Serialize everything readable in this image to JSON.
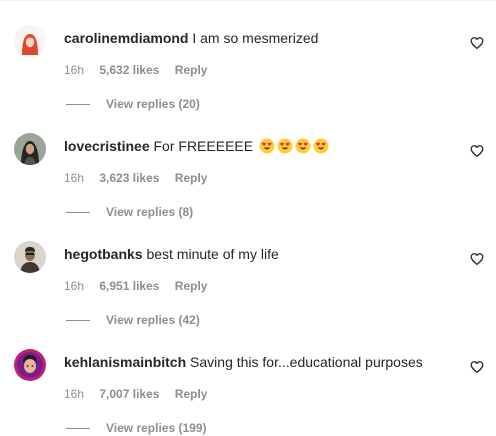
{
  "comments": [
    {
      "username": "carolinemdiamond",
      "text": "I am so mesmerized",
      "emoji_count": 0,
      "time": "16h",
      "likes": "5,632 likes",
      "reply": "Reply",
      "view_replies": "View replies (20)"
    },
    {
      "username": "lovecristinee",
      "text": "For FREEEEEE",
      "emoji_count": 4,
      "emoji": "heart-eyes-emoji",
      "time": "16h",
      "likes": "3,623 likes",
      "reply": "Reply",
      "view_replies": "View replies (8)"
    },
    {
      "username": "hegotbanks",
      "text": "best minute of my life",
      "emoji_count": 0,
      "time": "16h",
      "likes": "6,951 likes",
      "reply": "Reply",
      "view_replies": "View replies (42)"
    },
    {
      "username": "kehlanismainbitch",
      "text": "Saving this for...educational purposes",
      "emoji_count": 0,
      "time": "16h",
      "likes": "7,007 likes",
      "reply": "Reply",
      "view_replies": "View replies (199)"
    }
  ],
  "icons": {
    "like": "heart-outline-icon"
  },
  "colors": {
    "text": "#262626",
    "secondary": "#8e8e8e"
  }
}
